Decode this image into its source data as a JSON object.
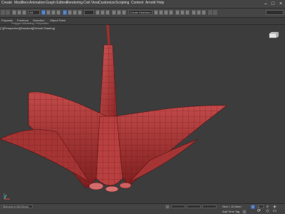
{
  "menubar": {
    "items": [
      "Create",
      "Modifiers",
      "Animation",
      "Graph Editors",
      "Rendering",
      "Civil View",
      "Customize",
      "Scripting",
      "Content",
      "Arnold",
      "Help"
    ],
    "window_controls": [
      "minimize-icon",
      "maximize-icon",
      "close-icon"
    ]
  },
  "toolbar": {
    "selection_filter": "All",
    "named_selection": "Create Selection Se"
  },
  "ribbon": {
    "items": [
      "Populate",
      "Freeform",
      "Selection",
      "Object Paint"
    ],
    "subitems": [
      "Polygon Modeling",
      "Properties"
    ]
  },
  "viewport": {
    "label": "[+][Perspective][Standard][Default Shading]",
    "object_color": "#b83a3a"
  },
  "statusbar": {
    "script_prompt": "Welcome to MAXScript.",
    "add_time_tag": "Add Time Tag",
    "grid_text": "Grid = 10.0mm",
    "frame": "0"
  }
}
